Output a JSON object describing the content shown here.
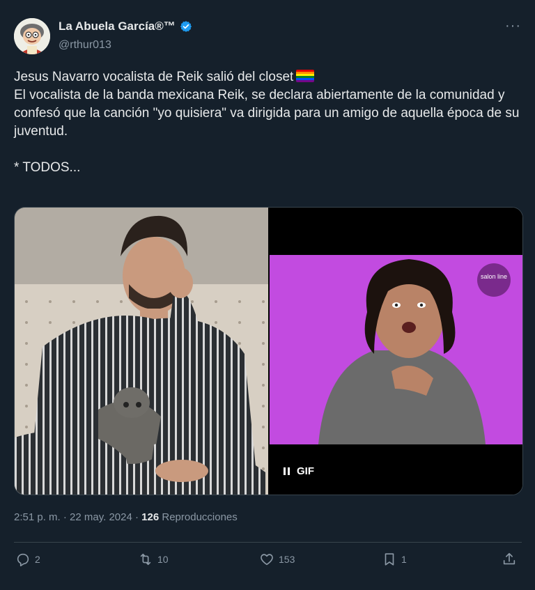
{
  "author": {
    "display_name": "La Abuela García®™",
    "handle": "@rthur013",
    "verified_icon": "verified-badge-icon",
    "verified_color": "#1d9bf0"
  },
  "more_icon": "more-options-icon",
  "more_label": "···",
  "post": {
    "line1": "Jesus Navarro vocalista de Reik salió del closet",
    "flag_icon": "rainbow-flag-emoji",
    "line2": "El vocalista de la banda mexicana Reik, se declara abiertamente de la comunidad y confesó que la canción \"yo quisiera\" va dirigida para un amigo de aquella época de su juventud.",
    "line3": "* TODOS..."
  },
  "media": {
    "left_image": "man-in-striped-pajamas-with-dog-photo",
    "right_image": "surprised-woman-purple-background-gif",
    "right_logo": "salon line",
    "gif_label": "GIF",
    "pause_icon": "pause-icon"
  },
  "meta": {
    "time": "2:51 p. m.",
    "separator": " · ",
    "date": "22 may. 2024",
    "views_count": "126",
    "views_label": "Reproducciones"
  },
  "actions": {
    "reply_count": "2",
    "retweet_count": "10",
    "like_count": "153",
    "bookmark_count": "1"
  },
  "colors": {
    "background": "#15202b",
    "text": "#e7e9ea",
    "secondary": "#8b98a5",
    "border": "#38444d",
    "gif_purple": "#c24be0"
  }
}
